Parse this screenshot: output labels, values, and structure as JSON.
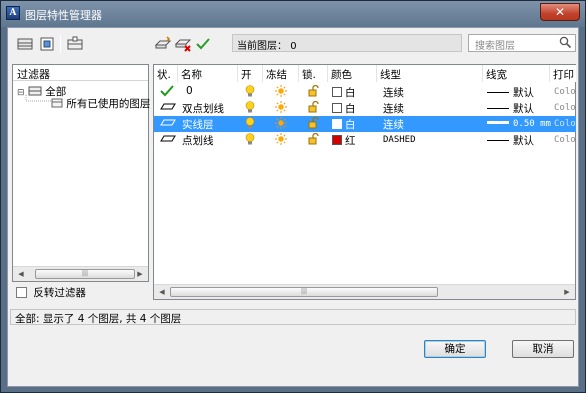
{
  "window": {
    "title": "图层特性管理器",
    "app_icon_text": "A",
    "close_label": "✕"
  },
  "toolbar": {
    "current_layer_label": "当前图层：",
    "current_layer_value": "0",
    "search_placeholder": "搜索图层"
  },
  "filters": {
    "header": "过滤器",
    "tree": [
      {
        "label": "全部"
      },
      {
        "label": "所有已使用的图层"
      }
    ],
    "invert_label": "反转过滤器"
  },
  "layers": {
    "columns": [
      "状.",
      "名称",
      "开",
      "冻结",
      "锁.",
      "颜色",
      "线型",
      "线宽",
      "打印"
    ],
    "rows": [
      {
        "status": "current",
        "name": "0",
        "color_name": "白",
        "color_hex": "#ffffff",
        "linetype": "连续",
        "lineweight": "默认",
        "plot": "Colo",
        "selected": false
      },
      {
        "status": "layer",
        "name": "双点划线",
        "color_name": "白",
        "color_hex": "#ffffff",
        "linetype": "连续",
        "lineweight": "默认",
        "plot": "Colo",
        "selected": false
      },
      {
        "status": "layer",
        "name": "实线层",
        "color_name": "白",
        "color_hex": "#ffffff",
        "linetype": "连续",
        "lineweight": "0.50 mm",
        "plot": "Colo",
        "selected": true
      },
      {
        "status": "layer",
        "name": "点划线",
        "color_name": "红",
        "color_hex": "#d40000",
        "linetype": "DASHED",
        "lineweight": "默认",
        "plot": "Colo",
        "selected": false
      }
    ]
  },
  "status_bar": {
    "text": "全部:  显示了 4 个图层, 共 4 个图层"
  },
  "buttons": {
    "ok": "确定",
    "cancel": "取消"
  },
  "colors": {
    "selection": "#3399ff",
    "title_bar": "#6f849c"
  }
}
